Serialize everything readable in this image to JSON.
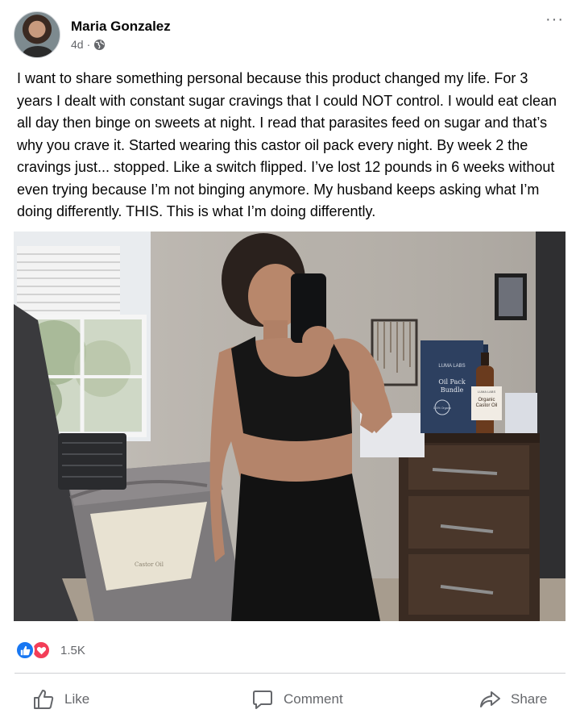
{
  "post": {
    "author": "Maria Gonzalez",
    "time": "4d",
    "separator": "·",
    "privacy_icon": "globe-icon",
    "more_icon": "more-options-icon",
    "more_label": "···",
    "text": "I want to share something personal because this product changed my life. For 3 years I dealt with constant sugar cravings that I could NOT control. I would eat clean all day then binge on sweets at night. I read that parasites feed on sugar and that’s why you crave it. Started wearing this castor oil pack every night. By week 2 the cravings just... stopped. Like a switch flipped. I’ve lost 12 pounds in 6 weeks without even trying because I’m not binging anymore. My husband keeps asking what I’m doing differently. THIS. This is what I’m doing differently."
  },
  "photo": {
    "box_brand": "LUMA LABS",
    "box_title_line1": "Oil Pack",
    "box_title_line2": "Bundle",
    "box_badge": "100% Organic",
    "bottle_brand": "LUMA LABS",
    "bottle_title_line1": "Organic",
    "bottle_title_line2": "Castor Oil",
    "towel_label": "Castor Oil"
  },
  "reactions": {
    "icons": [
      "like-reaction-icon",
      "love-reaction-icon"
    ],
    "count": "1.5K"
  },
  "actions": {
    "like_label": "Like",
    "comment_label": "Comment",
    "share_label": "Share"
  },
  "colors": {
    "like_blue": "#1877f2",
    "love_red": "#f33e58",
    "secondary_text": "#65676b"
  }
}
